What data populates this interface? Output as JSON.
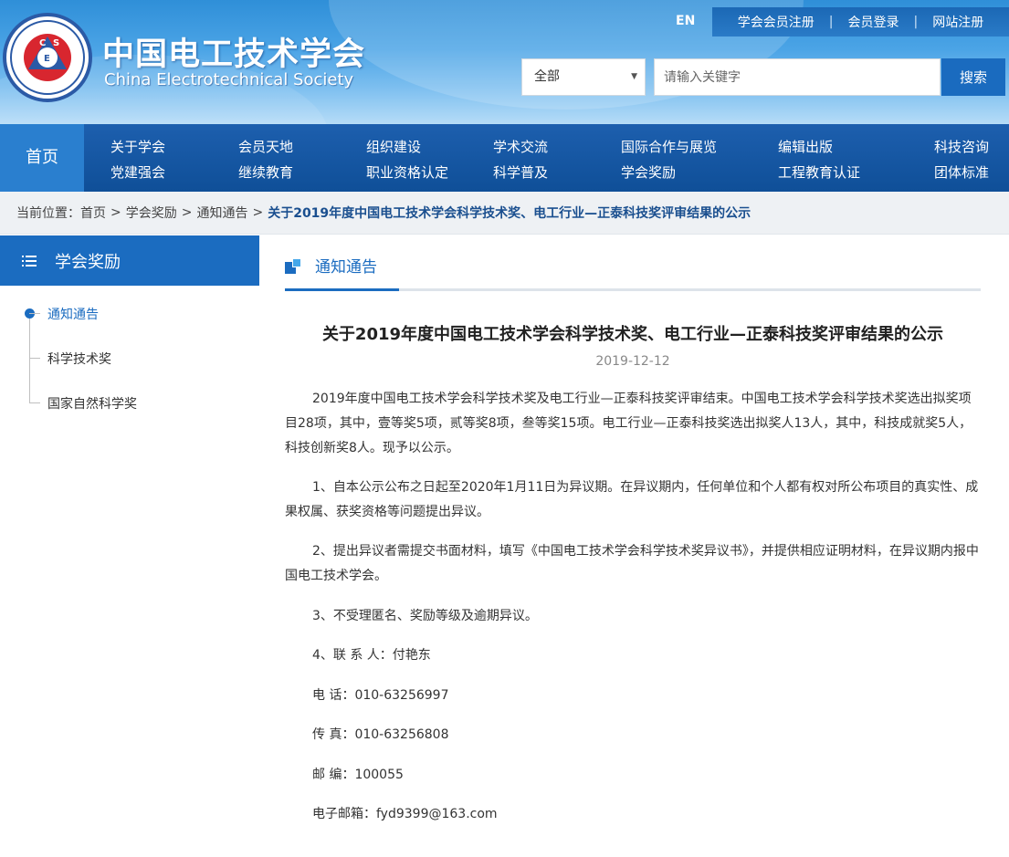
{
  "header": {
    "brand_cn": "中国电工技术学会",
    "brand_en": "China Electrotechnical Society",
    "logo_letters": [
      "C",
      "E",
      "S"
    ],
    "lang_label": "EN",
    "top_links": [
      "学会会员注册",
      "会员登录",
      "网站注册"
    ],
    "link_separator": "|",
    "search": {
      "scope_selected": "全部",
      "placeholder": "请输入关键字",
      "button_label": "搜索"
    }
  },
  "nav": {
    "home": "首页",
    "items_top": [
      "关于学会",
      "会员天地",
      "组织建设",
      "学术交流",
      "国际合作与展览",
      "编辑出版",
      "科技咨询"
    ],
    "items_bottom": [
      "党建强会",
      "继续教育",
      "职业资格认定",
      "科学普及",
      "学会奖励",
      "工程教育认证",
      "团体标准"
    ]
  },
  "breadcrumb": {
    "prefix": "当前位置：",
    "items": [
      "首页",
      "学会奖励",
      "通知通告"
    ],
    "current": "关于2019年度中国电工技术学会科学技术奖、电工行业—正泰科技奖评审结果的公示",
    "separator": ">"
  },
  "sidebar": {
    "title": "学会奖励",
    "items": [
      {
        "label": "通知通告",
        "active": true
      },
      {
        "label": "科学技术奖",
        "active": false
      },
      {
        "label": "国家自然科学奖",
        "active": false
      }
    ]
  },
  "content": {
    "section_title": "通知通告",
    "article": {
      "title": "关于2019年度中国电工技术学会科学技术奖、电工行业—正泰科技奖评审结果的公示",
      "date": "2019-12-12",
      "paragraphs": [
        "2019年度中国电工技术学会科学技术奖及电工行业—正泰科技奖评审结束。中国电工技术学会科学技术奖选出拟奖项目28项，其中，壹等奖5项，贰等奖8项，叁等奖15项。电工行业—正泰科技奖选出拟奖人13人，其中，科技成就奖5人，科技创新奖8人。现予以公示。",
        "1、自本公示公布之日起至2020年1月11日为异议期。在异议期内，任何单位和个人都有权对所公布项目的真实性、成果权属、获奖资格等问题提出异议。",
        "2、提出异议者需提交书面材料，填写《中国电工技术学会科学技术奖异议书》，并提供相应证明材料，在异议期内报中国电工技术学会。",
        "3、不受理匿名、奖励等级及逾期异议。",
        "4、联 系 人：付艳东",
        "电 话：010-63256997",
        "传 真：010-63256808",
        "邮 编：100055",
        "电子邮箱：fyd9399@163.com"
      ]
    }
  },
  "colors": {
    "primary_blue": "#1b6cc0",
    "nav_blue": "#0f4f98",
    "header_light": "#b6dcf7",
    "crumb_bg": "#eef1f4"
  }
}
